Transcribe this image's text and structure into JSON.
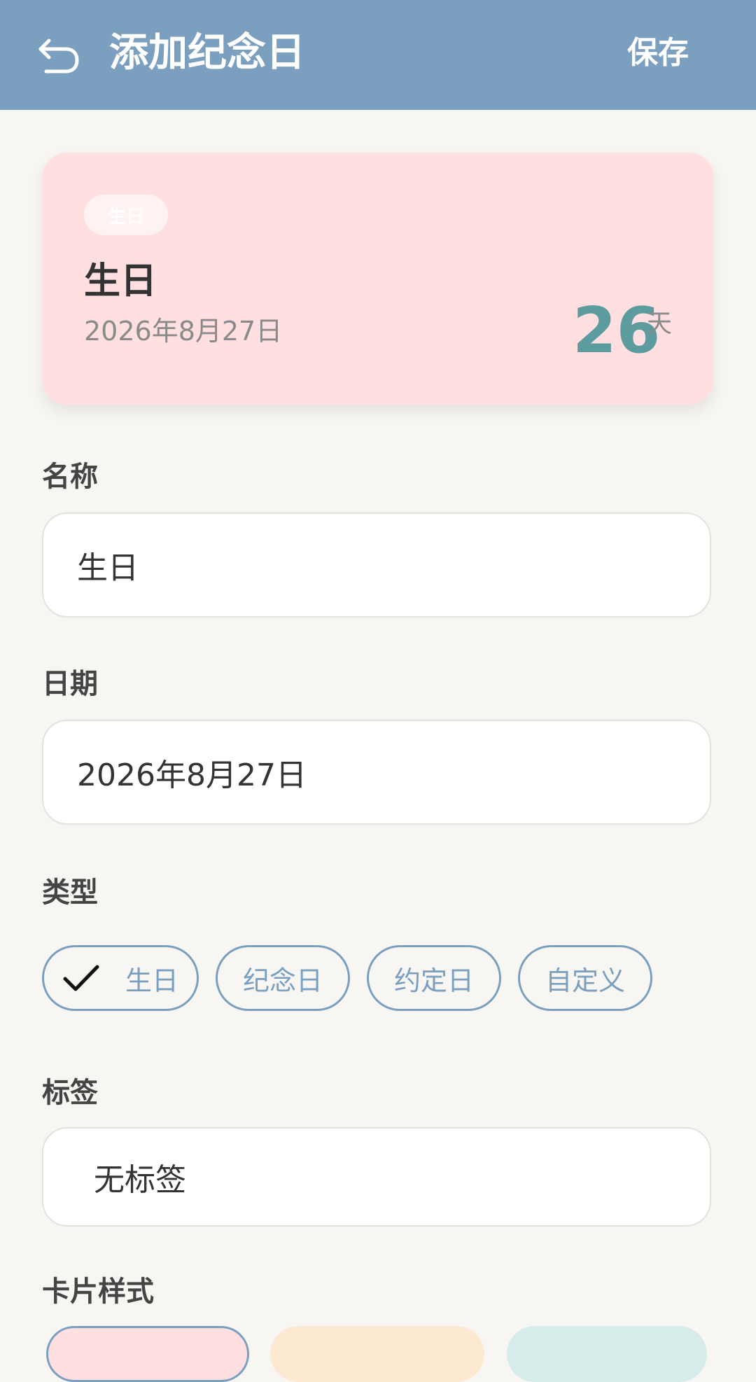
{
  "header": {
    "title": "添加纪念日",
    "save_label": "保存"
  },
  "preview": {
    "badge": "生日",
    "name": "生日",
    "date": "2026年8月27日",
    "days": "26",
    "unit": "天"
  },
  "form": {
    "name_label": "名称",
    "name_value": "生日",
    "date_label": "日期",
    "date_value": "2026年8月27日",
    "type_label": "类型",
    "types": [
      "生日",
      "纪念日",
      "约定日",
      "自定义"
    ],
    "selected_type": "生日",
    "tag_label": "标签",
    "tag_value": "无标签",
    "style_label": "卡片样式"
  },
  "colors": {
    "appbar": "#7b9fbf",
    "accent": "#7b9fbf",
    "card_pink": "#ffdfe0",
    "card_peach": "#fde8d2",
    "card_mint": "#d6ecea",
    "count": "#5c9b9e",
    "background": "#f7f6f3"
  },
  "icons": {
    "back": "undo-arrow-icon",
    "check": "check-icon"
  }
}
